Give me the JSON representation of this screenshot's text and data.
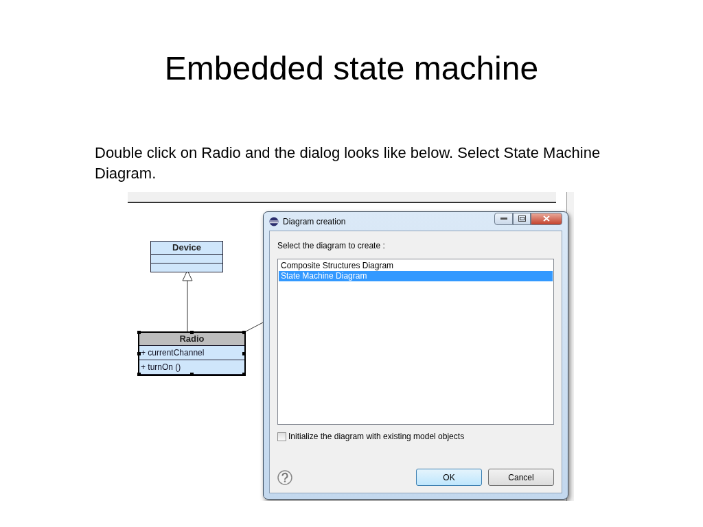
{
  "slide": {
    "title": "Embedded state machine",
    "text": "Double click on Radio and the dialog looks like below. Select State Machine Diagram."
  },
  "diagram": {
    "classes": [
      {
        "name": "Device",
        "selected": false
      },
      {
        "name": "Radio",
        "selected": true,
        "attributes": [
          "+ currentChannel"
        ],
        "operations": [
          "+ turnOn ()"
        ]
      }
    ]
  },
  "dialog": {
    "title": "Diagram creation",
    "prompt": "Select the diagram to create :",
    "items": [
      {
        "label": "Composite Structures Diagram",
        "selected": false
      },
      {
        "label": "State Machine Diagram",
        "selected": true
      }
    ],
    "checkbox": {
      "label": "Initialize the diagram with existing model objects",
      "checked": false
    },
    "buttons": [
      {
        "label": "OK",
        "kind": "default"
      },
      {
        "label": "Cancel",
        "kind": "normal"
      }
    ]
  }
}
